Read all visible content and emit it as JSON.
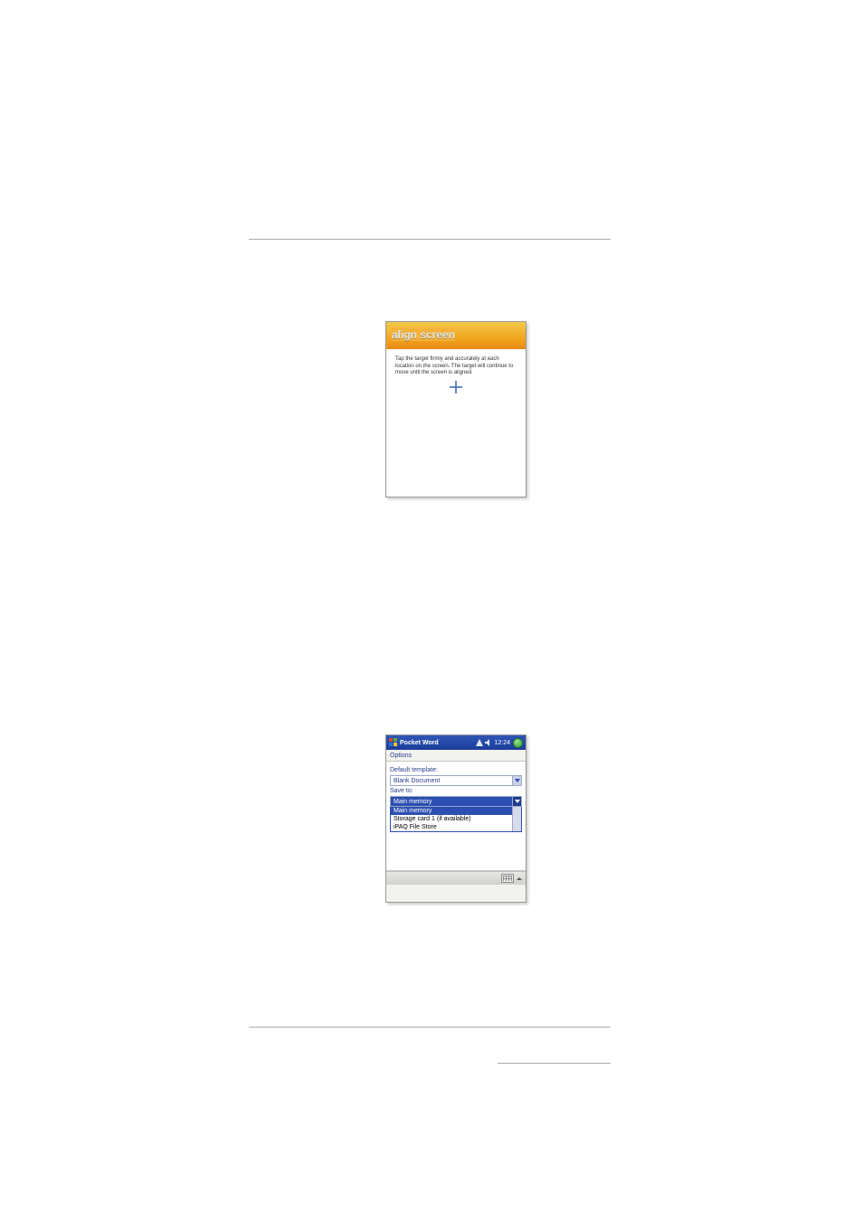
{
  "align": {
    "title": "align screen",
    "text": "Tap the target firmly and accurately at each location on the screen. The target will continue to move until the screen is aligned."
  },
  "pw": {
    "titlebar": {
      "app": "Pocket Word",
      "time": "12:24"
    },
    "options_label": "Options",
    "default_template_label": "Default template:",
    "default_template_value": "Blank Document",
    "save_to_label": "Save to:",
    "save_to_value": "Main memory",
    "dropdown": {
      "item_selected": "Main memory",
      "item_2": "Storage card 1 (if available)",
      "item_3": "iPAQ File Store"
    }
  }
}
